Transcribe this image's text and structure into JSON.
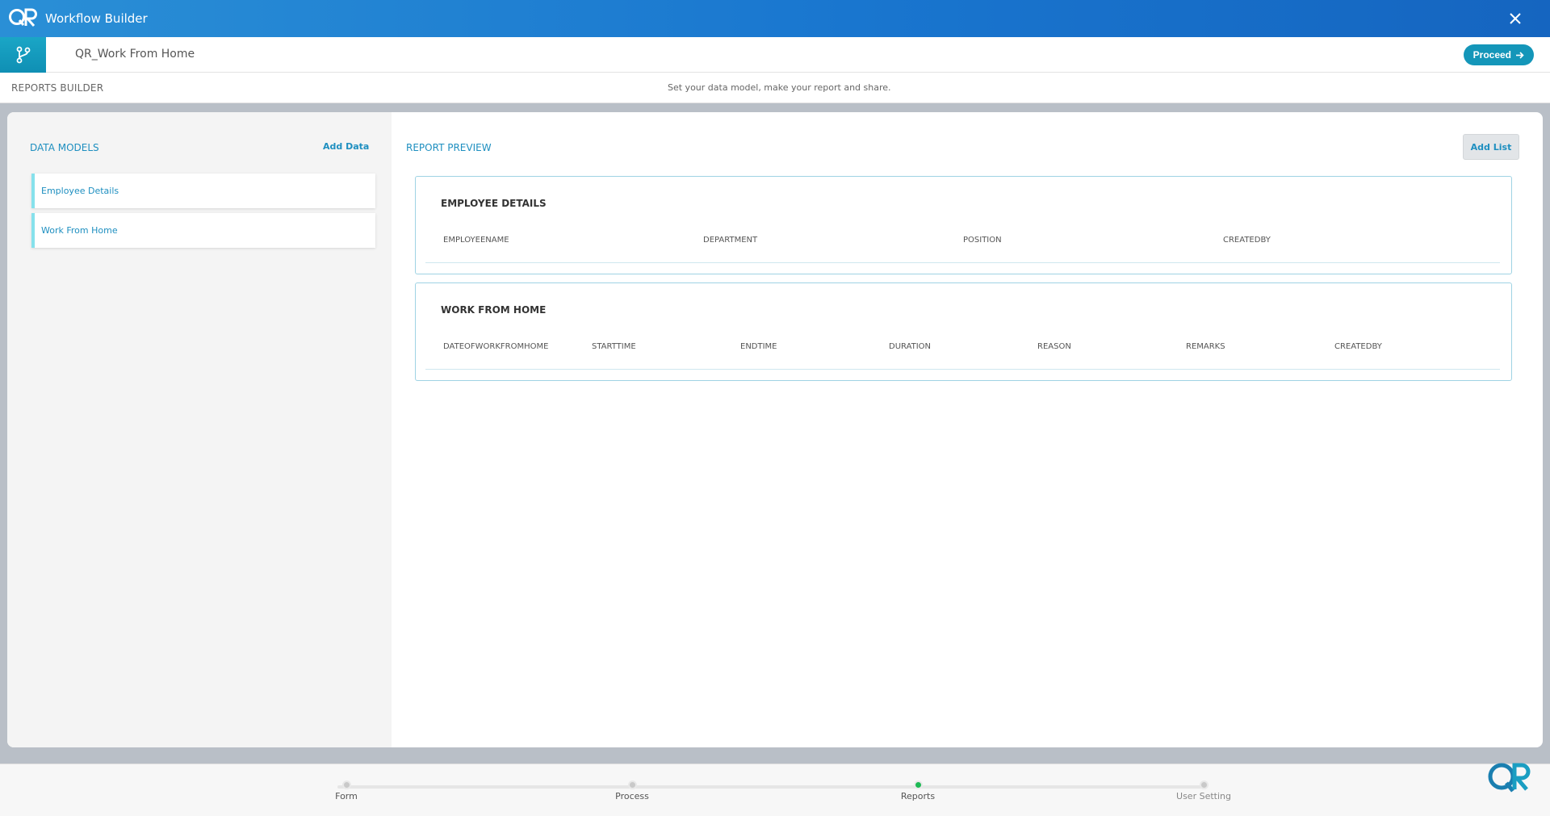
{
  "app": {
    "title": "Workflow Builder"
  },
  "workflow": {
    "name": "QR_Work From Home",
    "proceed_label": "Proceed"
  },
  "reports_builder": {
    "label": "REPORTS BUILDER",
    "hint": "Set your data model, make your report and share."
  },
  "data_models": {
    "header": "DATA MODELS",
    "add_label": "Add Data",
    "items": [
      {
        "label": "Employee Details"
      },
      {
        "label": "Work From Home"
      }
    ]
  },
  "report_preview": {
    "header": "REPORT PREVIEW",
    "add_list_label": "Add List",
    "lists": [
      {
        "title": "EMPLOYEE DETAILS",
        "columns": [
          "EMPLOYEENAME",
          "DEPARTMENT",
          "POSITION",
          "CREATEDBY"
        ]
      },
      {
        "title": "WORK FROM HOME",
        "columns": [
          "DATEOFWORKFROMHOME",
          "STARTTIME",
          "ENDTIME",
          "DURATION",
          "REASON",
          "REMARKS",
          "CREATEDBY"
        ]
      }
    ]
  },
  "stepper": {
    "steps": [
      {
        "label": "Form",
        "state": "inactive"
      },
      {
        "label": "Process",
        "state": "inactive"
      },
      {
        "label": "Reports",
        "state": "active"
      },
      {
        "label": "User Setting",
        "state": "inactive"
      }
    ],
    "active_color": "#1db954"
  },
  "colors": {
    "brand": "#1976cf",
    "accent": "#1e8fc0",
    "proceed": "#1496b9"
  },
  "icons": {
    "logo": "qr-logo-icon",
    "close": "close-icon",
    "workflow": "branch-icon",
    "proceed": "arrow-right-icon"
  }
}
